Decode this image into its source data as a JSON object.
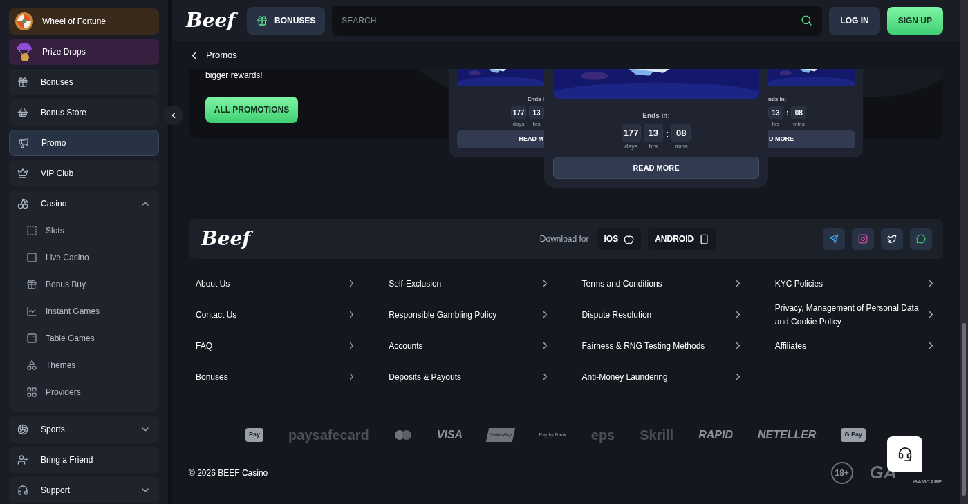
{
  "sidebar": {
    "items": [
      {
        "kind": "special",
        "label": "Wheel of Fortune",
        "color": "#3a2a1c"
      },
      {
        "kind": "special",
        "label": "Prize Drops",
        "color": "#35203f"
      },
      {
        "kind": "link",
        "label": "Bonuses",
        "selected": false
      },
      {
        "kind": "link",
        "label": "Bonus Store",
        "selected": false
      },
      {
        "kind": "link",
        "label": "Promo",
        "selected": true
      },
      {
        "kind": "link",
        "label": "VIP Club",
        "selected": false
      },
      {
        "kind": "group",
        "label": "Casino",
        "expanded": true,
        "children": [
          {
            "label": "Slots"
          },
          {
            "label": "Live Casino"
          },
          {
            "label": "Bonus Buy"
          },
          {
            "label": "Instant Games"
          },
          {
            "label": "Table Games"
          },
          {
            "label": "Themes"
          },
          {
            "label": "Providers"
          }
        ]
      },
      {
        "kind": "group",
        "label": "Sports",
        "expanded": false
      },
      {
        "kind": "link",
        "label": "Bring a Friend",
        "selected": false
      },
      {
        "kind": "group",
        "label": "Support",
        "expanded": false
      }
    ]
  },
  "header": {
    "logo": "Beef",
    "bonuses": "BONUSES",
    "search": {
      "placeholder": "SEARCH"
    },
    "login": "LOG IN",
    "signup": "SIGN UP"
  },
  "breadcrumb": "Promos",
  "banner": {
    "text": "bigger rewards!",
    "button": "ALL PROMOTIONS"
  },
  "cards": {
    "left": {
      "ends": "Ends i",
      "timer": [
        "177",
        "13"
      ],
      "units": [
        "days",
        "hrs"
      ],
      "button": "READ M"
    },
    "center": {
      "ends": "Ends in:",
      "timer": [
        "177",
        "13",
        "08"
      ],
      "units": [
        "days",
        "hrs",
        "mins"
      ],
      "separator": ":",
      "button": "READ MORE"
    },
    "right": {
      "ends": "nds in:",
      "timer": [
        "13",
        "08"
      ],
      "units": [
        "hrs",
        "mins"
      ],
      "separator": ":",
      "button": "D MORE"
    }
  },
  "footer": {
    "logo": "Beef",
    "download_label": "Download for",
    "apps": [
      "IOS",
      "ANDROID"
    ],
    "link_columns": [
      [
        "About Us",
        "Contact Us",
        "FAQ",
        "Bonuses"
      ],
      [
        "Self-Exclusion",
        "Responsible Gambling Policy",
        "Accounts",
        "Deposits & Payouts"
      ],
      [
        "Terms and Conditions",
        "Dispute Resolution",
        "Fairness & RNG Testing Methods",
        "Anti-Money Laundering"
      ],
      [
        "KYC Policies",
        "Privacy, Management of Personal Data and Cookie Policy",
        "Affiliates"
      ]
    ],
    "payments": [
      {
        "kind": "badge",
        "text": "Pay"
      },
      {
        "kind": "word",
        "text": "paysafecard"
      },
      {
        "kind": "circles"
      },
      {
        "kind": "bold",
        "text": "VISA"
      },
      {
        "kind": "slant",
        "text": "UnionPay"
      },
      {
        "kind": "small",
        "text": "Pay by Bank"
      },
      {
        "kind": "word",
        "text": "eps"
      },
      {
        "kind": "word",
        "text": "Skrill"
      },
      {
        "kind": "bold",
        "text": "RAPID"
      },
      {
        "kind": "bold",
        "text": "NETELLER"
      },
      {
        "kind": "badge",
        "text": "G Pay"
      }
    ],
    "copyright": "© 2026 BEEF Casino",
    "badges": [
      "18+",
      "GA",
      "GAMCARE"
    ]
  }
}
